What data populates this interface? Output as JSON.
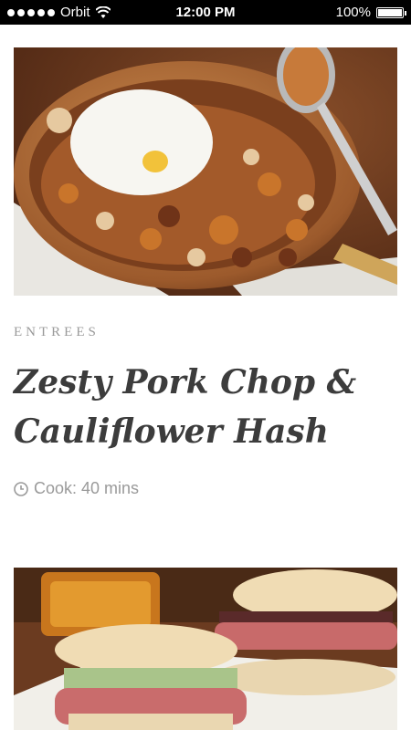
{
  "status_bar": {
    "carrier": "Orbit",
    "time": "12:00 PM",
    "battery": "100%"
  },
  "recipes": [
    {
      "category": "ENTREES",
      "title": "Zesty Pork Chop & Cauliflower Hash",
      "cook_label": "Cook: 40 mins"
    },
    {
      "image_icon": "sandwich-photo"
    }
  ]
}
